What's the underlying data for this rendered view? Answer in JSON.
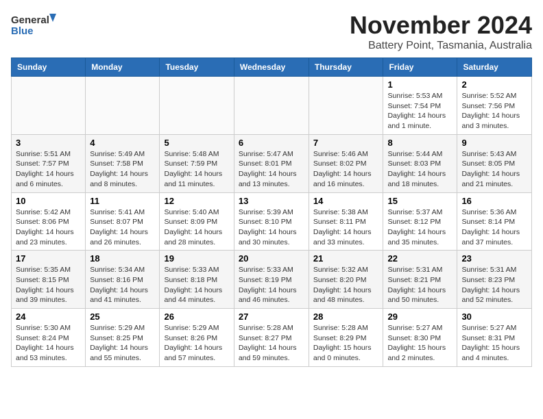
{
  "header": {
    "logo_general": "General",
    "logo_blue": "Blue",
    "title": "November 2024",
    "subtitle": "Battery Point, Tasmania, Australia"
  },
  "weekdays": [
    "Sunday",
    "Monday",
    "Tuesday",
    "Wednesday",
    "Thursday",
    "Friday",
    "Saturday"
  ],
  "weeks": [
    [
      {
        "day": "",
        "info": ""
      },
      {
        "day": "",
        "info": ""
      },
      {
        "day": "",
        "info": ""
      },
      {
        "day": "",
        "info": ""
      },
      {
        "day": "",
        "info": ""
      },
      {
        "day": "1",
        "info": "Sunrise: 5:53 AM\nSunset: 7:54 PM\nDaylight: 14 hours and 1 minute."
      },
      {
        "day": "2",
        "info": "Sunrise: 5:52 AM\nSunset: 7:56 PM\nDaylight: 14 hours and 3 minutes."
      }
    ],
    [
      {
        "day": "3",
        "info": "Sunrise: 5:51 AM\nSunset: 7:57 PM\nDaylight: 14 hours and 6 minutes."
      },
      {
        "day": "4",
        "info": "Sunrise: 5:49 AM\nSunset: 7:58 PM\nDaylight: 14 hours and 8 minutes."
      },
      {
        "day": "5",
        "info": "Sunrise: 5:48 AM\nSunset: 7:59 PM\nDaylight: 14 hours and 11 minutes."
      },
      {
        "day": "6",
        "info": "Sunrise: 5:47 AM\nSunset: 8:01 PM\nDaylight: 14 hours and 13 minutes."
      },
      {
        "day": "7",
        "info": "Sunrise: 5:46 AM\nSunset: 8:02 PM\nDaylight: 14 hours and 16 minutes."
      },
      {
        "day": "8",
        "info": "Sunrise: 5:44 AM\nSunset: 8:03 PM\nDaylight: 14 hours and 18 minutes."
      },
      {
        "day": "9",
        "info": "Sunrise: 5:43 AM\nSunset: 8:05 PM\nDaylight: 14 hours and 21 minutes."
      }
    ],
    [
      {
        "day": "10",
        "info": "Sunrise: 5:42 AM\nSunset: 8:06 PM\nDaylight: 14 hours and 23 minutes."
      },
      {
        "day": "11",
        "info": "Sunrise: 5:41 AM\nSunset: 8:07 PM\nDaylight: 14 hours and 26 minutes."
      },
      {
        "day": "12",
        "info": "Sunrise: 5:40 AM\nSunset: 8:09 PM\nDaylight: 14 hours and 28 minutes."
      },
      {
        "day": "13",
        "info": "Sunrise: 5:39 AM\nSunset: 8:10 PM\nDaylight: 14 hours and 30 minutes."
      },
      {
        "day": "14",
        "info": "Sunrise: 5:38 AM\nSunset: 8:11 PM\nDaylight: 14 hours and 33 minutes."
      },
      {
        "day": "15",
        "info": "Sunrise: 5:37 AM\nSunset: 8:12 PM\nDaylight: 14 hours and 35 minutes."
      },
      {
        "day": "16",
        "info": "Sunrise: 5:36 AM\nSunset: 8:14 PM\nDaylight: 14 hours and 37 minutes."
      }
    ],
    [
      {
        "day": "17",
        "info": "Sunrise: 5:35 AM\nSunset: 8:15 PM\nDaylight: 14 hours and 39 minutes."
      },
      {
        "day": "18",
        "info": "Sunrise: 5:34 AM\nSunset: 8:16 PM\nDaylight: 14 hours and 41 minutes."
      },
      {
        "day": "19",
        "info": "Sunrise: 5:33 AM\nSunset: 8:18 PM\nDaylight: 14 hours and 44 minutes."
      },
      {
        "day": "20",
        "info": "Sunrise: 5:33 AM\nSunset: 8:19 PM\nDaylight: 14 hours and 46 minutes."
      },
      {
        "day": "21",
        "info": "Sunrise: 5:32 AM\nSunset: 8:20 PM\nDaylight: 14 hours and 48 minutes."
      },
      {
        "day": "22",
        "info": "Sunrise: 5:31 AM\nSunset: 8:21 PM\nDaylight: 14 hours and 50 minutes."
      },
      {
        "day": "23",
        "info": "Sunrise: 5:31 AM\nSunset: 8:23 PM\nDaylight: 14 hours and 52 minutes."
      }
    ],
    [
      {
        "day": "24",
        "info": "Sunrise: 5:30 AM\nSunset: 8:24 PM\nDaylight: 14 hours and 53 minutes."
      },
      {
        "day": "25",
        "info": "Sunrise: 5:29 AM\nSunset: 8:25 PM\nDaylight: 14 hours and 55 minutes."
      },
      {
        "day": "26",
        "info": "Sunrise: 5:29 AM\nSunset: 8:26 PM\nDaylight: 14 hours and 57 minutes."
      },
      {
        "day": "27",
        "info": "Sunrise: 5:28 AM\nSunset: 8:27 PM\nDaylight: 14 hours and 59 minutes."
      },
      {
        "day": "28",
        "info": "Sunrise: 5:28 AM\nSunset: 8:29 PM\nDaylight: 15 hours and 0 minutes."
      },
      {
        "day": "29",
        "info": "Sunrise: 5:27 AM\nSunset: 8:30 PM\nDaylight: 15 hours and 2 minutes."
      },
      {
        "day": "30",
        "info": "Sunrise: 5:27 AM\nSunset: 8:31 PM\nDaylight: 15 hours and 4 minutes."
      }
    ]
  ]
}
